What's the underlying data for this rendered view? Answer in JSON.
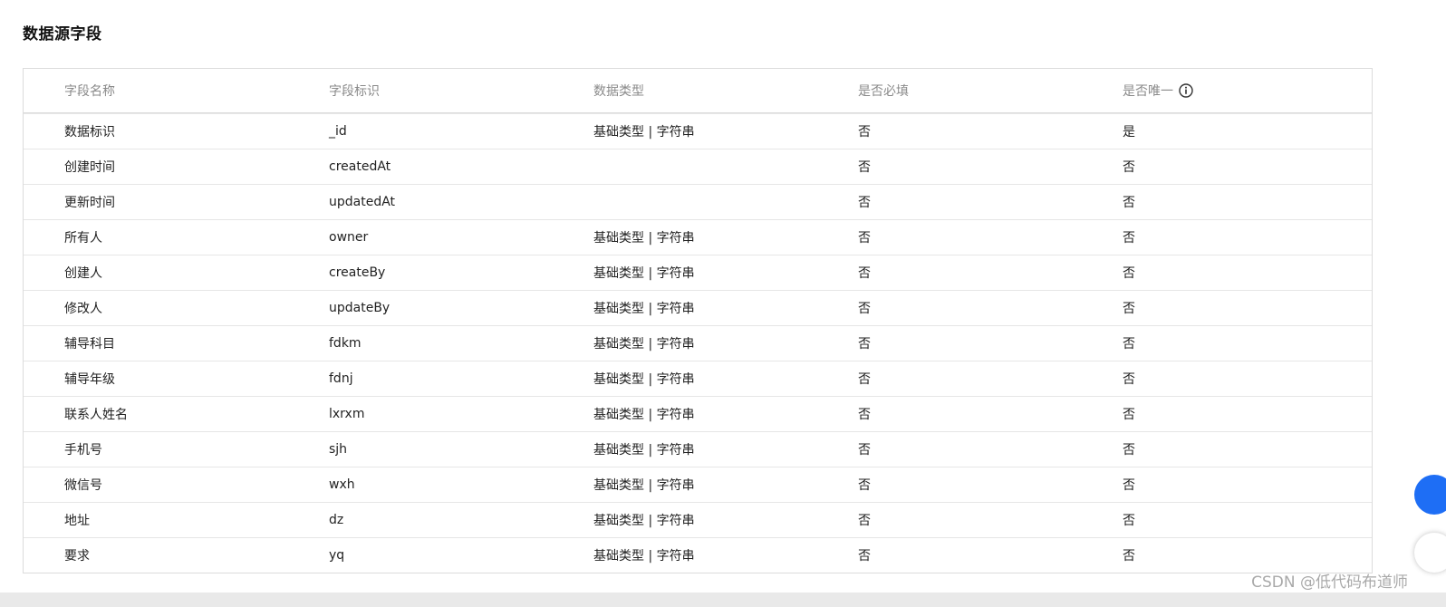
{
  "section": {
    "title": "数据源字段"
  },
  "table": {
    "headers": {
      "field_name": "字段名称",
      "field_id": "字段标识",
      "data_type": "数据类型",
      "required": "是否必填",
      "unique": "是否唯一",
      "unique_info_icon": "info-circle-icon"
    },
    "rows": [
      {
        "name": "数据标识",
        "id": "_id",
        "type": "基础类型 | 字符串",
        "required": "否",
        "unique": "是"
      },
      {
        "name": "创建时间",
        "id": "createdAt",
        "type": "",
        "required": "否",
        "unique": "否"
      },
      {
        "name": "更新时间",
        "id": "updatedAt",
        "type": "",
        "required": "否",
        "unique": "否"
      },
      {
        "name": "所有人",
        "id": "owner",
        "type": "基础类型 | 字符串",
        "required": "否",
        "unique": "否"
      },
      {
        "name": "创建人",
        "id": "createBy",
        "type": "基础类型 | 字符串",
        "required": "否",
        "unique": "否"
      },
      {
        "name": "修改人",
        "id": "updateBy",
        "type": "基础类型 | 字符串",
        "required": "否",
        "unique": "否"
      },
      {
        "name": "辅导科目",
        "id": "fdkm",
        "type": "基础类型 | 字符串",
        "required": "否",
        "unique": "否"
      },
      {
        "name": "辅导年级",
        "id": "fdnj",
        "type": "基础类型 | 字符串",
        "required": "否",
        "unique": "否"
      },
      {
        "name": "联系人姓名",
        "id": "lxrxm",
        "type": "基础类型 | 字符串",
        "required": "否",
        "unique": "否"
      },
      {
        "name": "手机号",
        "id": "sjh",
        "type": "基础类型 | 字符串",
        "required": "否",
        "unique": "否"
      },
      {
        "name": "微信号",
        "id": "wxh",
        "type": "基础类型 | 字符串",
        "required": "否",
        "unique": "否"
      },
      {
        "name": "地址",
        "id": "dz",
        "type": "基础类型 | 字符串",
        "required": "否",
        "unique": "否"
      },
      {
        "name": "要求",
        "id": "yq",
        "type": "基础类型 | 字符串",
        "required": "否",
        "unique": "否"
      }
    ]
  },
  "watermark": {
    "text": "CSDN @低代码布道师"
  },
  "colors": {
    "accent_button": "#1e6ef5",
    "header_text": "#8a8a8a",
    "border": "#dcdcdc"
  }
}
